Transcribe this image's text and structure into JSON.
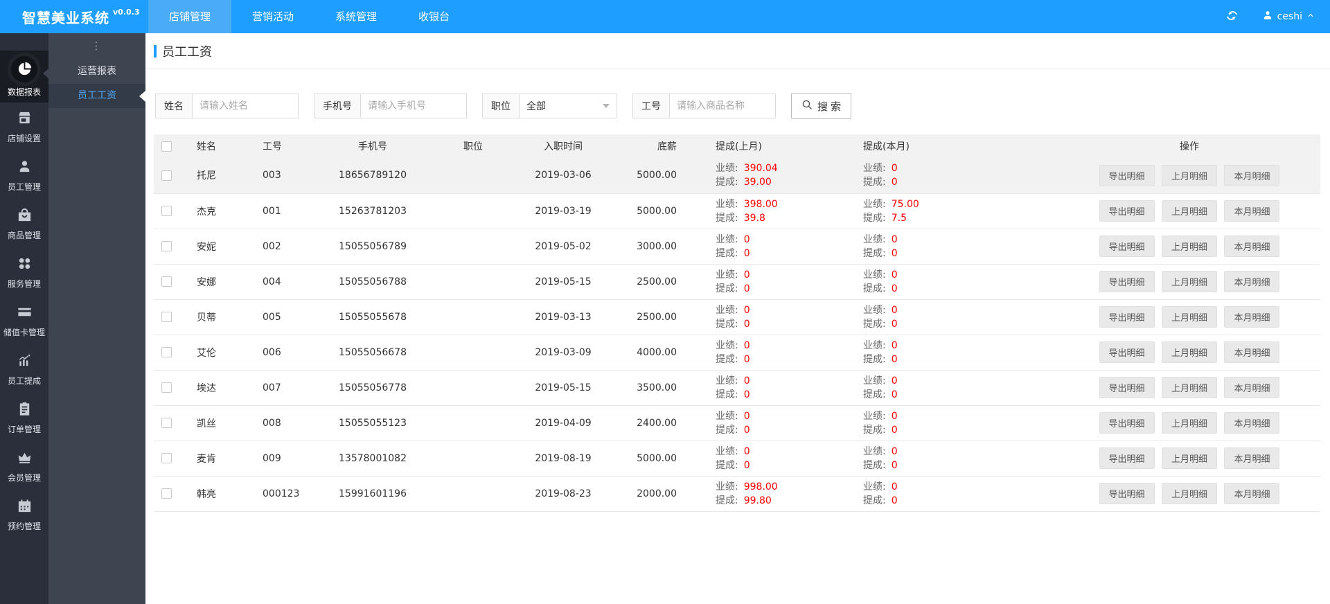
{
  "colors": {
    "topbar_blue": "#1E9FFF",
    "value_red": "#FF0000"
  },
  "topbar": {
    "logo": "智慧美业系统",
    "version": "v0.0.3",
    "tabs": [
      {
        "label": "店铺管理",
        "active": true
      },
      {
        "label": "营销活动",
        "active": false
      },
      {
        "label": "系统管理",
        "active": false
      },
      {
        "label": "收银台",
        "active": false
      }
    ],
    "user": {
      "name": "ceshi"
    }
  },
  "sidebar": {
    "items": [
      {
        "label": "数据报表",
        "icon": "pie-chart",
        "active": true
      },
      {
        "label": "店铺设置",
        "icon": "storefront",
        "active": false
      },
      {
        "label": "员工管理",
        "icon": "staff-person",
        "active": false
      },
      {
        "label": "商品管理",
        "icon": "shopping-bag",
        "active": false
      },
      {
        "label": "服务管理",
        "icon": "grid-dots",
        "active": false
      },
      {
        "label": "储值卡管理",
        "icon": "credit-card",
        "active": false
      },
      {
        "label": "员工提成",
        "icon": "trend-chart",
        "active": false
      },
      {
        "label": "订单管理",
        "icon": "clipboard",
        "active": false
      },
      {
        "label": "会员管理",
        "icon": "crown",
        "active": false
      },
      {
        "label": "预约管理",
        "icon": "calendar",
        "active": false
      }
    ]
  },
  "submenu": {
    "handle": "⋮",
    "items": [
      {
        "label": "运营报表",
        "active": false
      },
      {
        "label": "员工工资",
        "active": true
      }
    ]
  },
  "page": {
    "title": "员工工资"
  },
  "search": {
    "name_label": "姓名",
    "name_placeholder": "请输入姓名",
    "phone_label": "手机号",
    "phone_placeholder": "请输入手机号",
    "position_label": "职位",
    "position_value": "全部",
    "empno_label": "工号",
    "empno_placeholder": "请输入商品名称",
    "button_label": "搜 索"
  },
  "table": {
    "headers": [
      "姓名",
      "工号",
      "手机号",
      "职位",
      "入职时间",
      "底薪",
      "提成(上月)",
      "提成(本月)",
      "操作"
    ],
    "perf_label": "业绩:",
    "comm_label": "提成:",
    "actions": [
      "导出明细",
      "上月明细",
      "本月明细"
    ],
    "rows": [
      {
        "name": "托尼",
        "emp_no": "003",
        "phone": "18656789120",
        "position": "",
        "hire_date": "2019-03-06",
        "base_salary": "5000.00",
        "last_month": {
          "perf": "390.04",
          "comm": "39.00"
        },
        "this_month": {
          "perf": "0",
          "comm": "0"
        }
      },
      {
        "name": "杰克",
        "emp_no": "001",
        "phone": "15263781203",
        "position": "",
        "hire_date": "2019-03-19",
        "base_salary": "5000.00",
        "last_month": {
          "perf": "398.00",
          "comm": "39.8"
        },
        "this_month": {
          "perf": "75.00",
          "comm": "7.5"
        }
      },
      {
        "name": "安妮",
        "emp_no": "002",
        "phone": "15055056789",
        "position": "",
        "hire_date": "2019-05-02",
        "base_salary": "3000.00",
        "last_month": {
          "perf": "0",
          "comm": "0"
        },
        "this_month": {
          "perf": "0",
          "comm": "0"
        }
      },
      {
        "name": "安娜",
        "emp_no": "004",
        "phone": "15055056788",
        "position": "",
        "hire_date": "2019-05-15",
        "base_salary": "2500.00",
        "last_month": {
          "perf": "0",
          "comm": "0"
        },
        "this_month": {
          "perf": "0",
          "comm": "0"
        }
      },
      {
        "name": "贝蒂",
        "emp_no": "005",
        "phone": "15055055678",
        "position": "",
        "hire_date": "2019-03-13",
        "base_salary": "2500.00",
        "last_month": {
          "perf": "0",
          "comm": "0"
        },
        "this_month": {
          "perf": "0",
          "comm": "0"
        }
      },
      {
        "name": "艾伦",
        "emp_no": "006",
        "phone": "15055056678",
        "position": "",
        "hire_date": "2019-03-09",
        "base_salary": "4000.00",
        "last_month": {
          "perf": "0",
          "comm": "0"
        },
        "this_month": {
          "perf": "0",
          "comm": "0"
        }
      },
      {
        "name": "埃达",
        "emp_no": "007",
        "phone": "15055056778",
        "position": "",
        "hire_date": "2019-05-15",
        "base_salary": "3500.00",
        "last_month": {
          "perf": "0",
          "comm": "0"
        },
        "this_month": {
          "perf": "0",
          "comm": "0"
        }
      },
      {
        "name": "凯丝",
        "emp_no": "008",
        "phone": "15055055123",
        "position": "",
        "hire_date": "2019-04-09",
        "base_salary": "2400.00",
        "last_month": {
          "perf": "0",
          "comm": "0"
        },
        "this_month": {
          "perf": "0",
          "comm": "0"
        }
      },
      {
        "name": "麦肯",
        "emp_no": "009",
        "phone": "13578001082",
        "position": "",
        "hire_date": "2019-08-19",
        "base_salary": "5000.00",
        "last_month": {
          "perf": "0",
          "comm": "0"
        },
        "this_month": {
          "perf": "0",
          "comm": "0"
        }
      },
      {
        "name": "韩亮",
        "emp_no": "000123",
        "phone": "15991601196",
        "position": "",
        "hire_date": "2019-08-23",
        "base_salary": "2000.00",
        "last_month": {
          "perf": "998.00",
          "comm": "99.80"
        },
        "this_month": {
          "perf": "0",
          "comm": "0"
        }
      }
    ]
  }
}
